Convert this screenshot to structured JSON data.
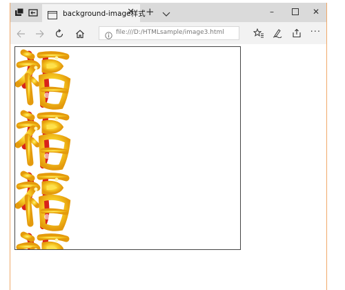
{
  "window": {
    "tab": {
      "title": "background-image样式",
      "close_icon": "close-icon",
      "page_icon": "page-icon"
    },
    "new_tab_label": "+",
    "controls": {
      "minimize": "–",
      "maximize": "☐",
      "close": "✕"
    }
  },
  "toolbar": {
    "back_icon": "back-arrow-icon",
    "forward_icon": "forward-arrow-icon",
    "refresh_icon": "refresh-icon",
    "home_icon": "home-icon",
    "address": "file:///D:/HTMLsample/image3.html",
    "favorites_icon": "favorites-icon",
    "pen_icon": "pen-icon",
    "share_icon": "share-icon",
    "more_label": "···"
  },
  "content": {
    "tile_image": "fu-character-image",
    "tile_repeat_count": 4,
    "colors": {
      "gold": "#f3c21c",
      "red": "#d8231a",
      "highlight": "#ffe766"
    }
  }
}
